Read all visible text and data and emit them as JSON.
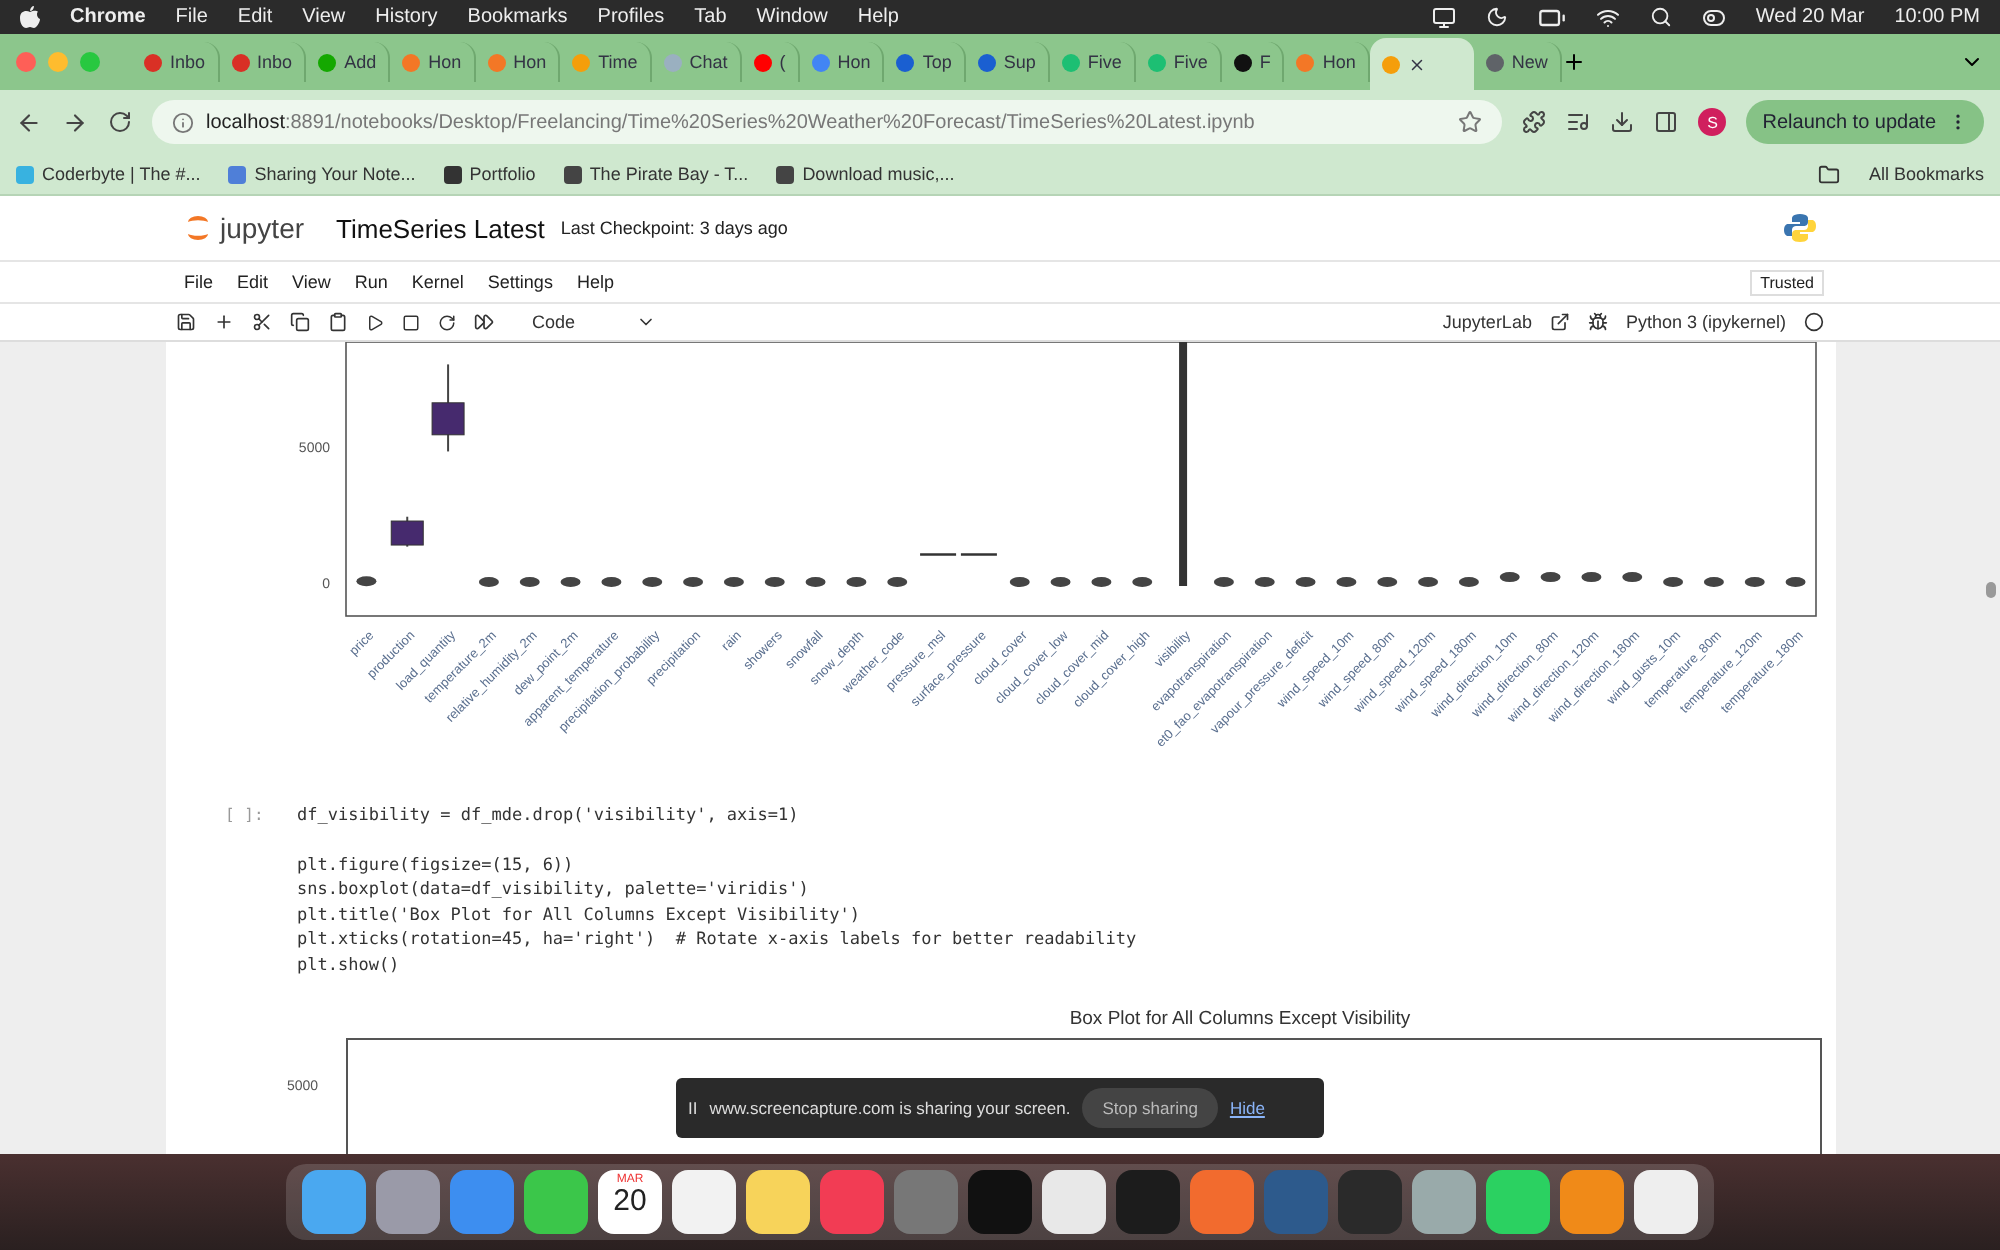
{
  "menubar": {
    "app": "Chrome",
    "items": [
      "File",
      "Edit",
      "View",
      "History",
      "Bookmarks",
      "Profiles",
      "Tab",
      "Window",
      "Help"
    ],
    "date": "Wed 20 Mar",
    "time": "10:00 PM"
  },
  "tabs": [
    {
      "label": "Inbo",
      "color": "#d93025",
      "selected": false
    },
    {
      "label": "Inbo",
      "color": "#d93025",
      "selected": false
    },
    {
      "label": "Add",
      "color": "#14a800",
      "selected": false
    },
    {
      "label": "Hon",
      "color": "#f37726",
      "selected": false
    },
    {
      "label": "Hon",
      "color": "#f37726",
      "selected": false
    },
    {
      "label": "Time",
      "color": "#f59e0b",
      "selected": false
    },
    {
      "label": "Chat",
      "color": "#9ab0c0",
      "selected": false
    },
    {
      "label": "(",
      "color": "#ff0000",
      "selected": false
    },
    {
      "label": "Hon",
      "color": "#4285f4",
      "selected": false
    },
    {
      "label": "Top",
      "color": "#1a5fd1",
      "selected": false
    },
    {
      "label": "Sup",
      "color": "#1a5fd1",
      "selected": false
    },
    {
      "label": "Five",
      "color": "#1dbf73",
      "selected": false
    },
    {
      "label": "Five",
      "color": "#1dbf73",
      "selected": false
    },
    {
      "label": "F",
      "color": "#111111",
      "selected": false
    },
    {
      "label": "Hon",
      "color": "#f37726",
      "selected": false
    },
    {
      "color": "#f59e0b",
      "selected": true
    },
    {
      "label": "New",
      "color": "#5f6368",
      "selected": false
    }
  ],
  "address": {
    "host": "localhost",
    "path": ":8891/notebooks/Desktop/Freelancing/Time%20Series%20Weather%20Forecast/TimeSeries%20Latest.ipynb"
  },
  "relaunch": "Relaunch to update",
  "profile": "S",
  "bookmarks": [
    "Coderbyte | The #...",
    "Sharing Your Note...",
    "Portfolio",
    "The Pirate Bay - T...",
    "Download music,..."
  ],
  "all_bookmarks": "All Bookmarks",
  "jupyter": {
    "logo": "jupyter",
    "title": "TimeSeries Latest",
    "checkpoint": "Last Checkpoint: 3 days ago",
    "menu": [
      "File",
      "Edit",
      "View",
      "Run",
      "Kernel",
      "Settings",
      "Help"
    ],
    "trusted": "Trusted",
    "cell_type": "Code",
    "jupyterlab": "JupyterLab",
    "kernel": "Python 3 (ipykernel)"
  },
  "chart": {
    "yticks": [
      "5000",
      "0"
    ],
    "columns": [
      "price",
      "production",
      "load_quantity",
      "temperature_2m",
      "relative_humidity_2m",
      "dew_point_2m",
      "apparent_temperature",
      "precipitation_probability",
      "precipitation",
      "rain",
      "showers",
      "snowfall",
      "snow_depth",
      "weather_code",
      "pressure_msl",
      "surface_pressure",
      "cloud_cover",
      "cloud_cover_low",
      "cloud_cover_mid",
      "cloud_cover_high",
      "visibility",
      "evapotranspiration",
      "et0_fao_evapotranspiration",
      "vapour_pressure_deficit",
      "wind_speed_10m",
      "wind_speed_80m",
      "wind_speed_120m",
      "wind_speed_180m",
      "wind_direction_10m",
      "wind_direction_80m",
      "wind_direction_120m",
      "wind_direction_180m",
      "wind_gusts_10m",
      "temperature_80m",
      "temperature_120m",
      "temperature_180m"
    ]
  },
  "cell": {
    "prompt": "[ ]:",
    "blocks": [
      [
        "df_visibility = df_mde.drop('visibility', axis=1)"
      ],
      [
        "plt.figure(figsize=(15, 6))",
        "sns.boxplot(data=df_visibility, palette='viridis')",
        "plt.title('Box Plot for All Columns Except Visibility')",
        "plt.xticks(rotation=45, ha='right')  # Rotate x-axis labels for better readability",
        "plt.show()"
      ]
    ]
  },
  "chart2": {
    "title": "Box Plot for All Columns Except Visibility",
    "ytick": "5000"
  },
  "share_bar": {
    "pause": "II",
    "message": "www.screencapture.com is sharing your screen.",
    "stop": "Stop sharing",
    "hide": "Hide"
  },
  "dock": {
    "month": "MAR",
    "day": "20"
  }
}
